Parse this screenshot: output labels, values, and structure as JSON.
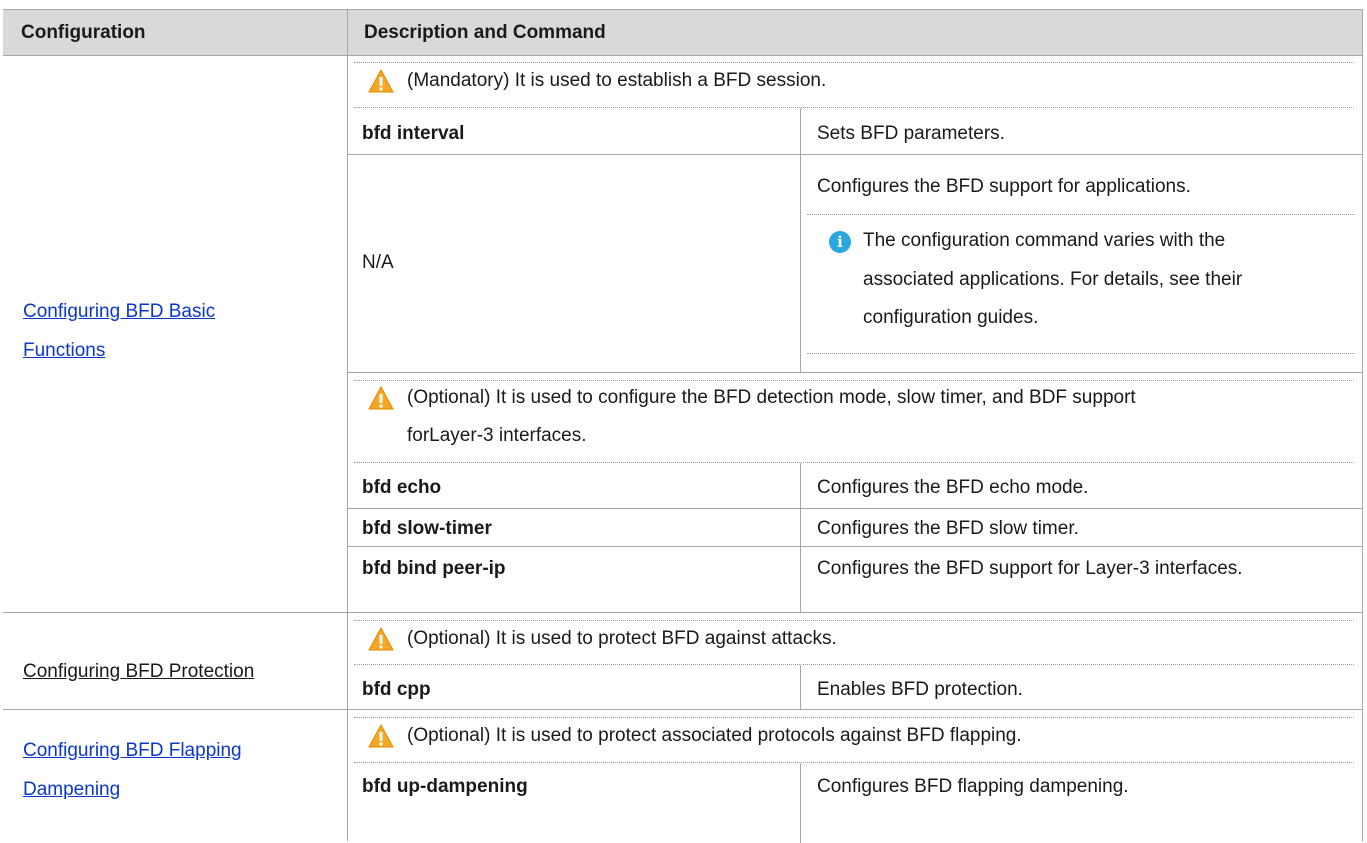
{
  "header": {
    "col1": "Configuration",
    "col2": "Description and Command"
  },
  "sections": [
    {
      "config_link": "Configuring BFD Basic Functions",
      "config_link_line1": "Configuring BFD Basic",
      "config_link_line2": "Functions",
      "blocks": [
        {
          "note": "(Mandatory) It is used to establish a BFD session.",
          "rows": [
            {
              "command": "bfd interval",
              "description": "Sets BFD parameters."
            },
            {
              "command": "N/A",
              "description": "Configures the BFD support for applications.",
              "info_note_line1": "The configuration command varies with the",
              "info_note_line2": "associated applications. For details, see their",
              "info_note_line3": "configuration guides."
            }
          ]
        },
        {
          "note_line1": "(Optional) It is used to configure the BFD detection mode, slow timer, and BDF support",
          "note_line2": "forLayer-3 interfaces.",
          "rows": [
            {
              "command": "bfd echo",
              "description": "Configures the BFD echo mode."
            },
            {
              "command": "bfd slow-timer",
              "description": "Configures the BFD slow timer."
            },
            {
              "command": "bfd bind peer-ip",
              "description": "Configures the BFD support for Layer-3 interfaces."
            }
          ]
        }
      ]
    },
    {
      "config_link": "Configuring BFD Protection",
      "note": "(Optional) It is used to protect BFD against attacks.",
      "rows": [
        {
          "command": "bfd cpp",
          "description": "Enables BFD protection."
        }
      ]
    },
    {
      "config_link_line1": "Configuring BFD Flapping",
      "config_link_line2": "Dampening",
      "note": "(Optional) It is used to protect associated protocols against BFD flapping.",
      "rows": [
        {
          "command": "bfd up-dampening",
          "description": "Configures BFD flapping dampening."
        }
      ]
    }
  ],
  "icons": {
    "warning": "warning-icon",
    "info": "info-icon",
    "warning_color": "#f5a623",
    "info_color": "#2aa6e0",
    "link_color": "#0b38c8"
  }
}
